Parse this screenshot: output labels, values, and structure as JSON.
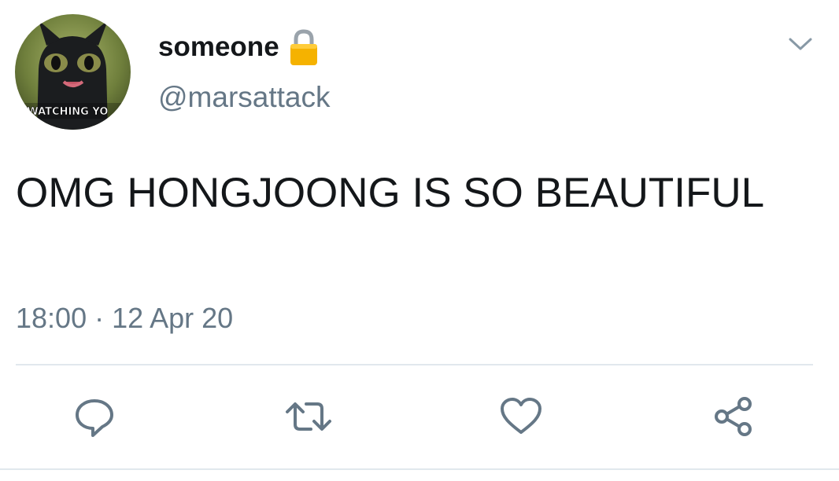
{
  "user": {
    "display_name": "someone",
    "handle": "@marsattack",
    "avatar_caption": "I WATCHING YO",
    "protected_icon": "lock-icon"
  },
  "tweet": {
    "text": "OMG HONGJOONG IS SO BEAUTIFUL",
    "timestamp": "18:00 · 12 Apr 20"
  },
  "menu": {
    "icon": "chevron-down-icon"
  },
  "actions": [
    {
      "name": "reply",
      "icon": "comment-bubble-icon"
    },
    {
      "name": "retweet",
      "icon": "retweet-icon"
    },
    {
      "name": "like",
      "icon": "heart-icon"
    },
    {
      "name": "share",
      "icon": "share-icon"
    }
  ],
  "colors": {
    "text_primary": "#14171a",
    "text_secondary": "#657786",
    "icon_gray": "#657786",
    "divider": "#e1e8ed",
    "lock_gold": "#f5b200"
  }
}
